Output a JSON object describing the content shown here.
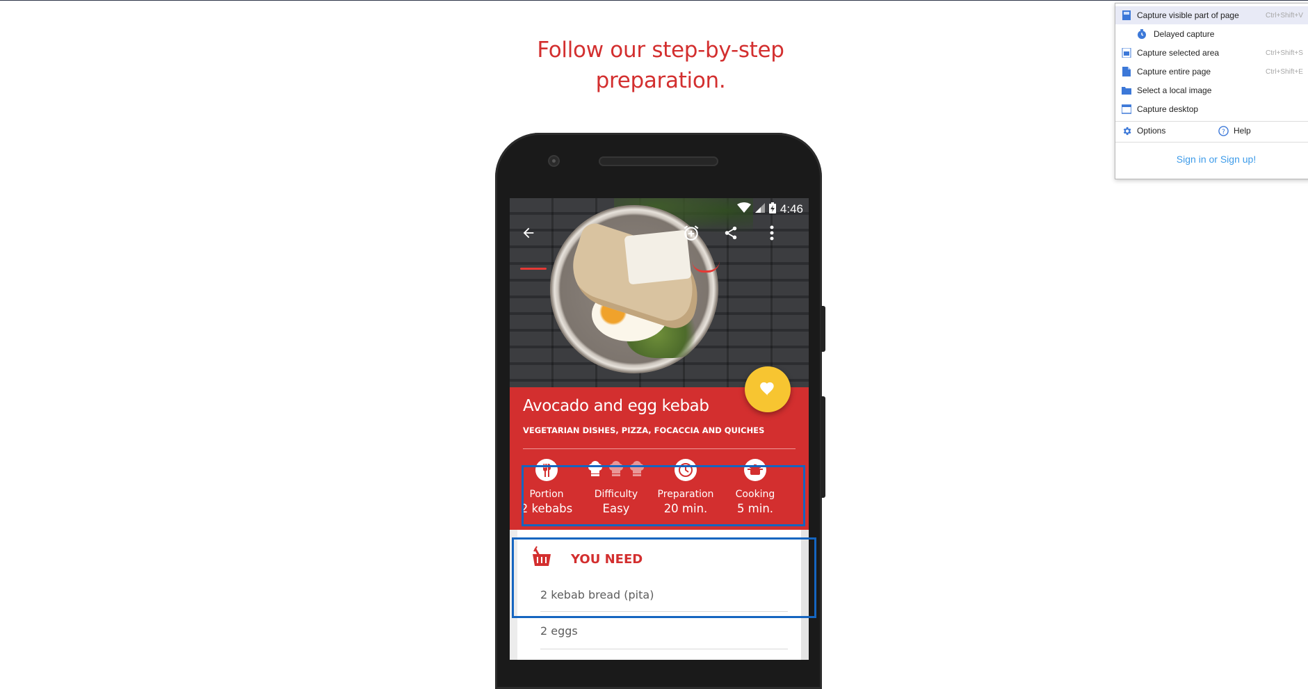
{
  "page": {
    "headline_line1": "Follow our step-by-step",
    "headline_line2": "preparation."
  },
  "phone": {
    "status_bar": {
      "time": "4:46"
    },
    "app_bar": {
      "icons": [
        "back-arrow-icon",
        "alarm-add-icon",
        "share-icon",
        "more-vert-icon"
      ]
    },
    "recipe": {
      "title": "Avocado and egg kebab",
      "category": "VEGETARIAN DISHES, PIZZA, FOCACCIA AND QUICHES",
      "stats": [
        {
          "label": "Portion",
          "value": "2 kebabs",
          "icon": "cutlery-icon"
        },
        {
          "label": "Difficulty",
          "value": "Easy",
          "icon": "chef-hat-icon",
          "level": 1,
          "max": 3
        },
        {
          "label": "Preparation",
          "value": "20 min.",
          "icon": "clock-icon"
        },
        {
          "label": "Cooking",
          "value": "5 min.",
          "icon": "pot-icon"
        }
      ]
    },
    "ingredients": {
      "heading": "YOU NEED",
      "items": [
        "2 kebab bread (pita)",
        "2 eggs"
      ]
    }
  },
  "capture_menu": {
    "items": [
      {
        "label": "Capture visible part of page",
        "shortcut": "Ctrl+Shift+V",
        "icon": "page-visible-icon"
      },
      {
        "label": "Delayed capture",
        "shortcut": "",
        "icon": "timer-icon"
      },
      {
        "label": "Capture selected area",
        "shortcut": "Ctrl+Shift+S",
        "icon": "selection-icon"
      },
      {
        "label": "Capture entire page",
        "shortcut": "Ctrl+Shift+E",
        "icon": "page-entire-icon"
      },
      {
        "label": "Select a local image",
        "shortcut": "",
        "icon": "folder-icon"
      },
      {
        "label": "Capture desktop",
        "shortcut": "",
        "icon": "desktop-icon"
      }
    ],
    "options_label": "Options",
    "help_label": "Help",
    "signin_label": "Sign in or Sign up!"
  },
  "colors": {
    "brand_red": "#d32f2f",
    "fab_yellow": "#f7c531",
    "highlight_blue": "#1565c0",
    "menu_link": "#3d9be9"
  }
}
